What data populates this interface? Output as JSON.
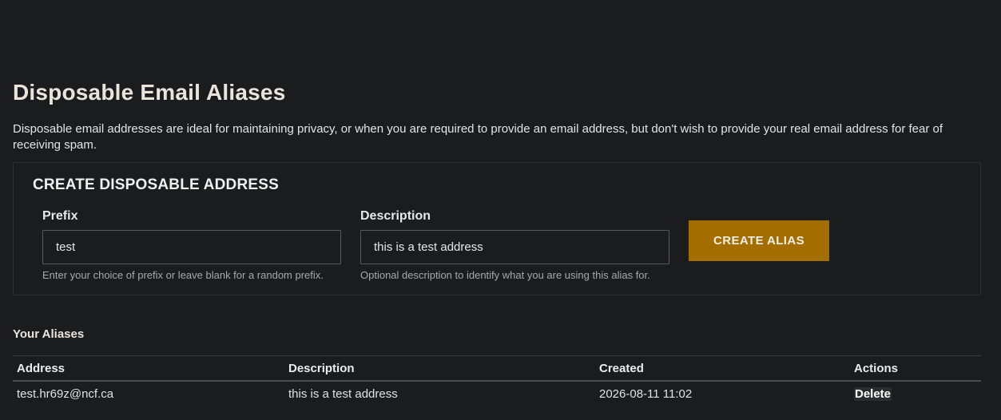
{
  "page": {
    "title": "Disposable Email Aliases",
    "intro": "Disposable email addresses are ideal for maintaining privacy, or when you are required to provide an email address, but don't wish to provide your real email address for fear of receiving spam."
  },
  "create_form": {
    "heading": "CREATE DISPOSABLE ADDRESS",
    "prefix": {
      "label": "Prefix",
      "value": "test",
      "help": "Enter your choice of prefix or leave blank for a random prefix."
    },
    "description": {
      "label": "Description",
      "value": "this is a test address",
      "help": "Optional description to identify what you are using this alias for."
    },
    "submit_label": "CREATE ALIAS",
    "accent_color": "#a36d00"
  },
  "aliases": {
    "heading": "Your Aliases",
    "columns": [
      "Address",
      "Description",
      "Created",
      "Actions"
    ],
    "rows": [
      {
        "address": "test.hr69z@ncf.ca",
        "description": "this is a test address",
        "created": "2026-08-11 11:02",
        "action": "Delete"
      }
    ]
  }
}
